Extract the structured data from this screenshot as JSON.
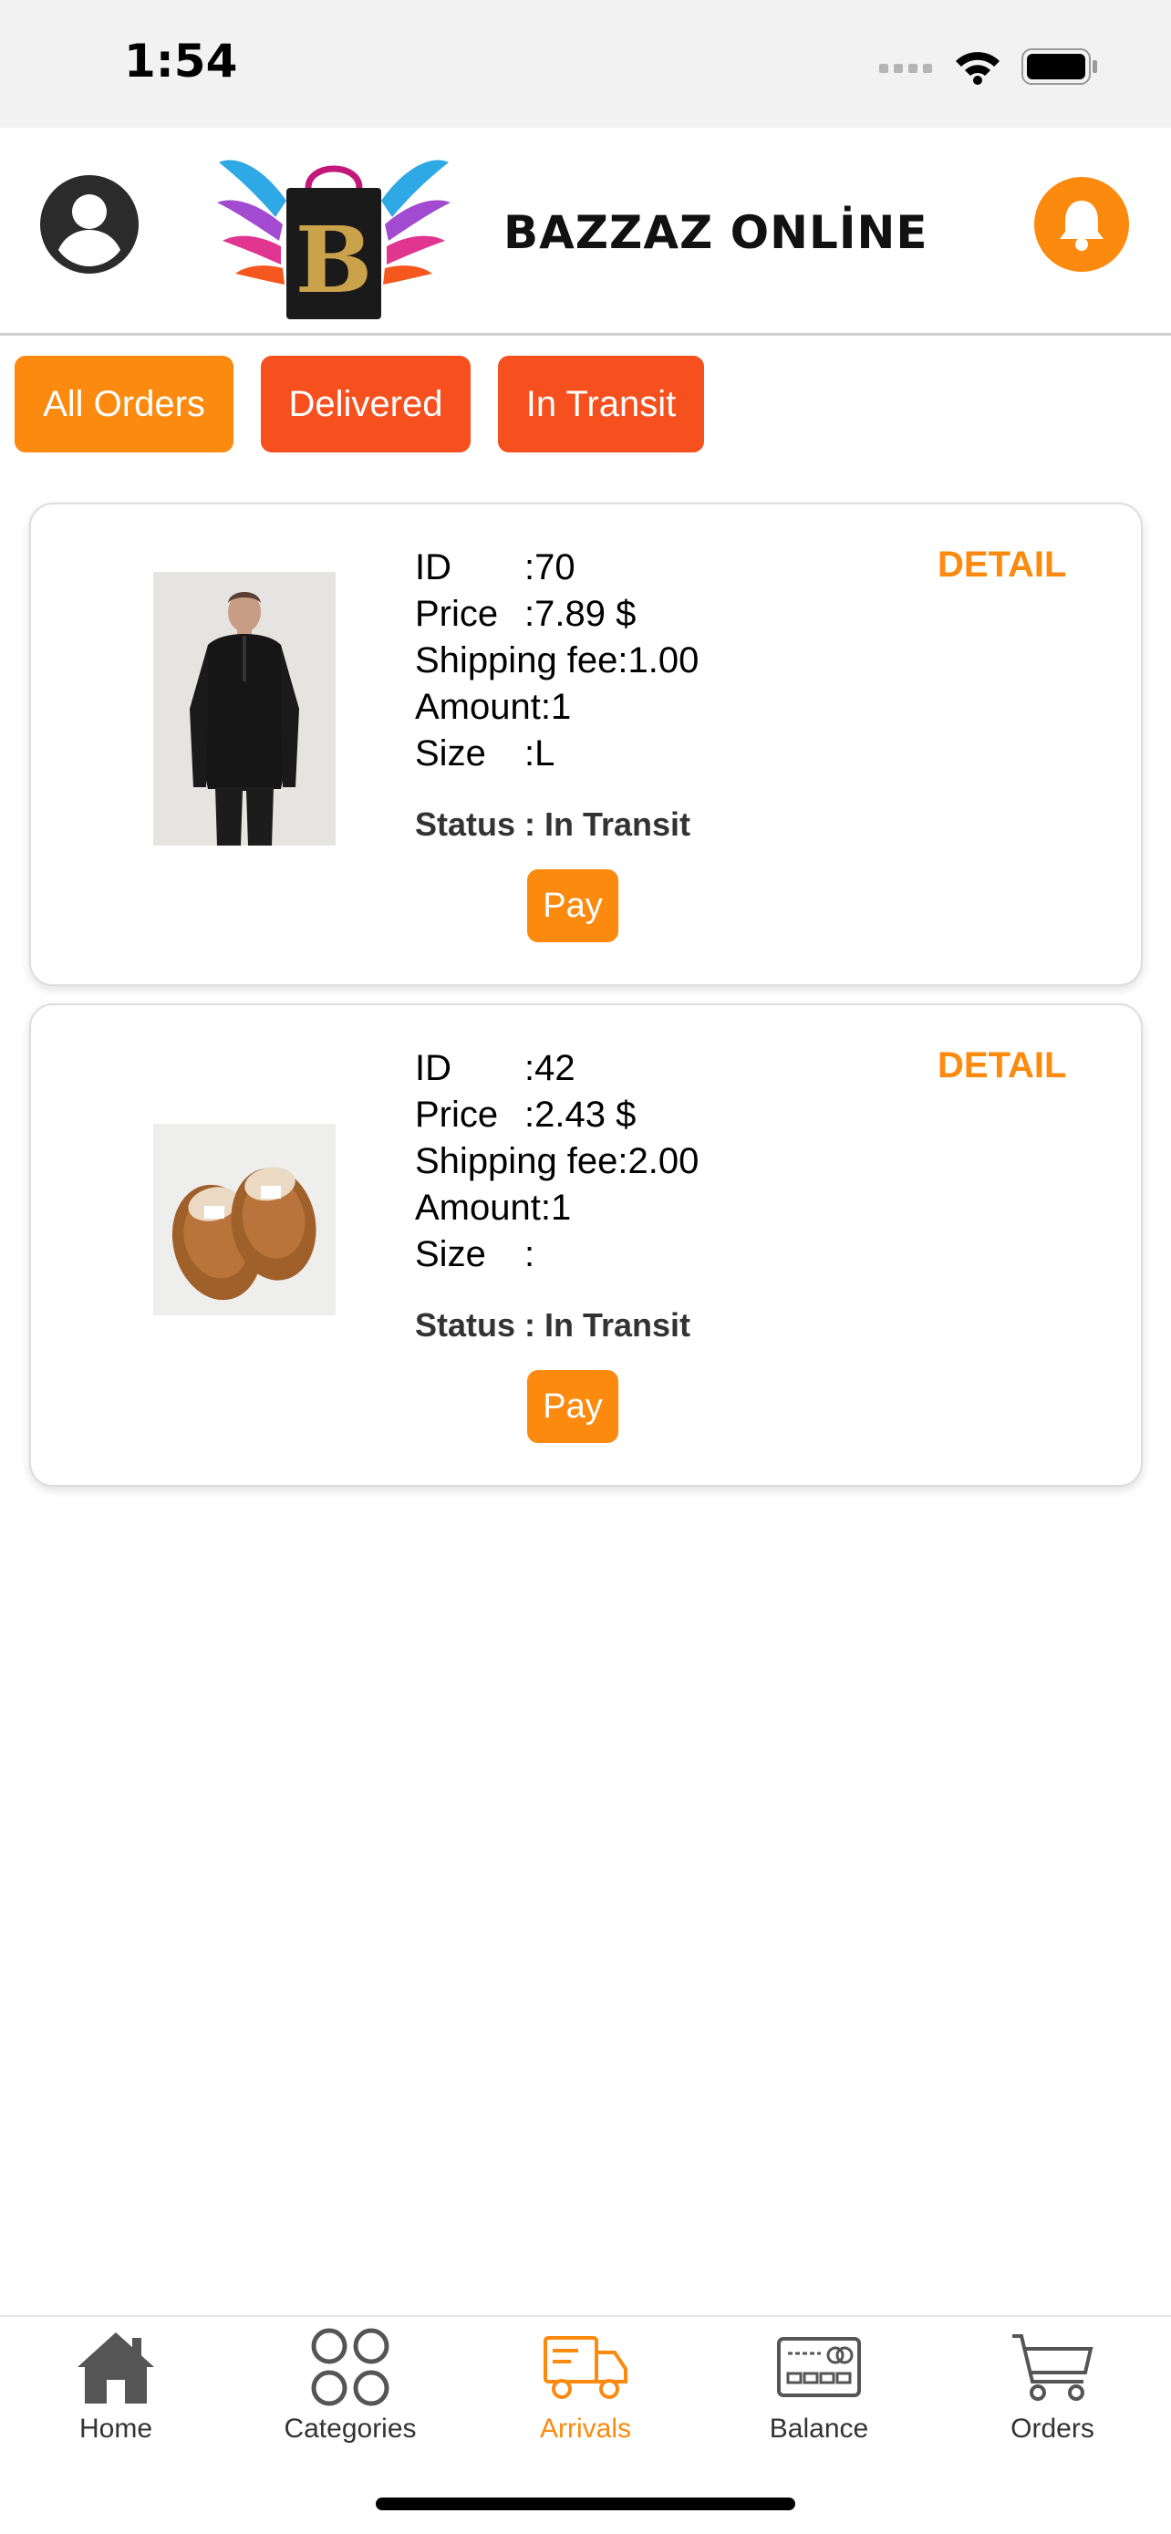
{
  "status_bar": {
    "time": "1:54"
  },
  "header": {
    "brand": "BAZZAZ ONLİNE"
  },
  "tabs": [
    {
      "label": "All Orders"
    },
    {
      "label": "Delivered"
    },
    {
      "label": "In Transit"
    }
  ],
  "orders": [
    {
      "id_label": "ID",
      "id_value": ":70",
      "price_label": "Price",
      "price_value": ":7.89 $",
      "shipping": "Shipping fee:1.00",
      "amount": "Amount:1",
      "size_label": "Size",
      "size_value": ":L",
      "status": "Status :  In Transit",
      "pay_label": "Pay",
      "detail_label": "DETAIL",
      "image": "black-zip-sweater"
    },
    {
      "id_label": "ID",
      "id_value": ":42",
      "price_label": "Price",
      "price_value": ":2.43 $",
      "shipping": "Shipping fee:2.00",
      "amount": "Amount:1",
      "size_label": "Size",
      "size_value": ":",
      "status": "Status :  In Transit",
      "pay_label": "Pay",
      "detail_label": "DETAIL",
      "image": "brown-slippers"
    }
  ],
  "bottom_nav": [
    {
      "label": "Home",
      "icon": "home-icon"
    },
    {
      "label": "Categories",
      "icon": "categories-icon"
    },
    {
      "label": "Arrivals",
      "icon": "truck-icon",
      "active": true
    },
    {
      "label": "Balance",
      "icon": "card-icon"
    },
    {
      "label": "Orders",
      "icon": "cart-icon"
    }
  ],
  "colors": {
    "accent": "#fb8a0e",
    "tab_red": "#f5501e"
  }
}
